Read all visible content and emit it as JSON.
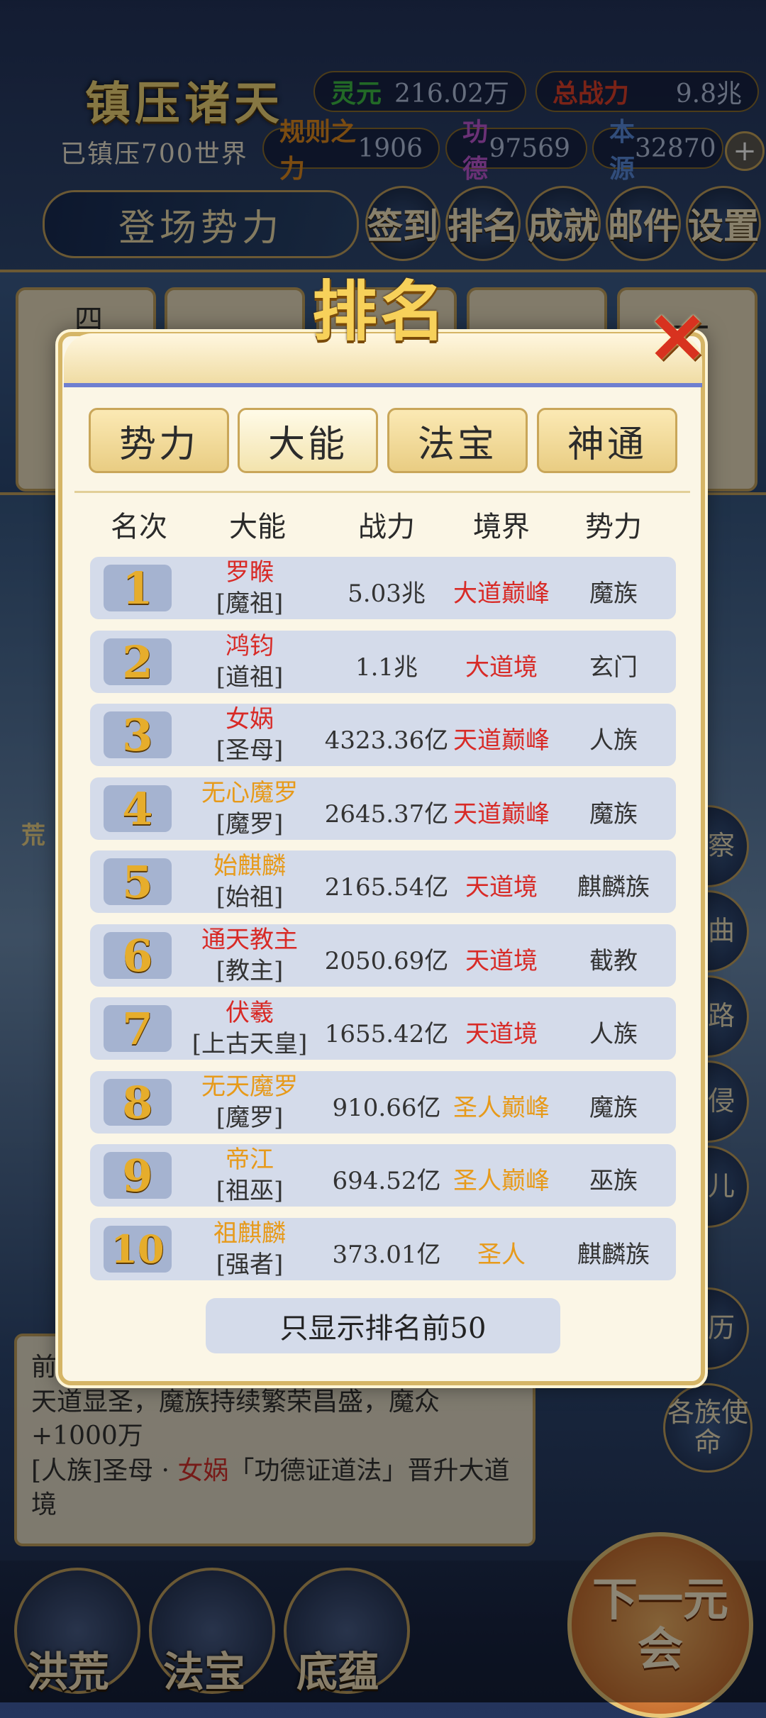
{
  "header": {
    "game_title": "镇压诸天",
    "subtitle": "已镇压700世界",
    "stats": [
      {
        "label": "灵元",
        "value": "216.02万",
        "color": "#3fbf45"
      },
      {
        "label": "总战力",
        "value": "9.8兆",
        "color": "#e0402b"
      },
      {
        "label": "规则之力",
        "value": "1906",
        "color": "#e08a1f"
      },
      {
        "label": "功德",
        "value": "97569",
        "color": "#c25ad8"
      },
      {
        "label": "本源",
        "value": "32870",
        "color": "#5a8de0"
      }
    ],
    "plus_label": "+",
    "enter_label": "登场势力",
    "nav_buttons": [
      "签到",
      "排名",
      "成就",
      "邮件",
      "设置"
    ]
  },
  "background": {
    "cards_left_text": "四海汪洋",
    "cards_right_text": "玄门",
    "side_label": "荒",
    "right_buttons": [
      "元察",
      "悟曲",
      "道路",
      "域侵",
      "道儿",
      "身历",
      "各族使命"
    ]
  },
  "news": {
    "title": "前2",
    "line1": "天道显圣，魔族持续繁荣昌盛，魔众+1000万",
    "line2_prefix": "[人族]圣母 · ",
    "line2_name": "女娲",
    "line2_suffix": "「功德证道法」晋升大道境"
  },
  "bottom": {
    "buttons": [
      "洪荒",
      "法宝",
      "底蕴"
    ],
    "next_label": "下一元会"
  },
  "modal": {
    "title": "排名",
    "close_label": "✕",
    "tabs": [
      "势力",
      "大能",
      "法宝",
      "神通"
    ],
    "active_tab": "大能",
    "columns": [
      "名次",
      "大能",
      "战力",
      "境界",
      "势力"
    ],
    "rows": [
      {
        "rank": "1",
        "name": "罗睺",
        "title": "[魔祖]",
        "power": "5.03兆",
        "realm": "大道巅峰",
        "faction": "魔族",
        "name_color": "red",
        "realm_color": "red"
      },
      {
        "rank": "2",
        "name": "鸿钧",
        "title": "[道祖]",
        "power": "1.1兆",
        "realm": "大道境",
        "faction": "玄门",
        "name_color": "red",
        "realm_color": "red"
      },
      {
        "rank": "3",
        "name": "女娲",
        "title": "[圣母]",
        "power": "4323.36亿",
        "realm": "天道巅峰",
        "faction": "人族",
        "name_color": "red",
        "realm_color": "red"
      },
      {
        "rank": "4",
        "name": "无心魔罗",
        "title": "[魔罗]",
        "power": "2645.37亿",
        "realm": "天道巅峰",
        "faction": "魔族",
        "name_color": "orange",
        "realm_color": "red"
      },
      {
        "rank": "5",
        "name": "始麒麟",
        "title": "[始祖]",
        "power": "2165.54亿",
        "realm": "天道境",
        "faction": "麒麟族",
        "name_color": "orange",
        "realm_color": "red"
      },
      {
        "rank": "6",
        "name": "通天教主",
        "title": "[教主]",
        "power": "2050.69亿",
        "realm": "天道境",
        "faction": "截教",
        "name_color": "red",
        "realm_color": "red"
      },
      {
        "rank": "7",
        "name": "伏羲",
        "title": "[上古天皇]",
        "power": "1655.42亿",
        "realm": "天道境",
        "faction": "人族",
        "name_color": "red",
        "realm_color": "red"
      },
      {
        "rank": "8",
        "name": "无天魔罗",
        "title": "[魔罗]",
        "power": "910.66亿",
        "realm": "圣人巅峰",
        "faction": "魔族",
        "name_color": "orange",
        "realm_color": "orange"
      },
      {
        "rank": "9",
        "name": "帝江",
        "title": "[祖巫]",
        "power": "694.52亿",
        "realm": "圣人巅峰",
        "faction": "巫族",
        "name_color": "orange",
        "realm_color": "orange"
      },
      {
        "rank": "10",
        "name": "祖麒麟",
        "title": "[强者]",
        "power": "373.01亿",
        "realm": "圣人",
        "faction": "麒麟族",
        "name_color": "orange",
        "realm_color": "orange"
      }
    ],
    "footer_label": "只显示排名前50"
  }
}
